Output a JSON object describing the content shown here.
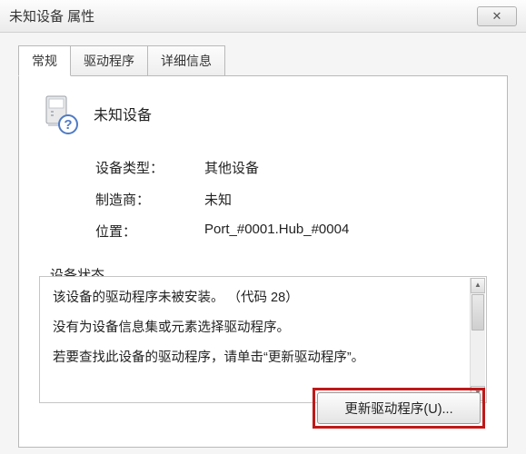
{
  "window": {
    "title": "未知设备 属性"
  },
  "tabs": {
    "general": "常规",
    "driver": "驱动程序",
    "details": "详细信息"
  },
  "device": {
    "name": "未知设备"
  },
  "info": {
    "type_label": "设备类型：",
    "type_value": "其他设备",
    "manufacturer_label": "制造商：",
    "manufacturer_value": "未知",
    "location_label": "位置：",
    "location_value": "Port_#0001.Hub_#0004"
  },
  "status": {
    "group_label": "设备状态",
    "line1": "该设备的驱动程序未被安装。 （代码 28）",
    "line2": "没有为设备信息集或元素选择驱动程序。",
    "line3": "若要查找此设备的驱动程序，请单击“更新驱动程序”。"
  },
  "buttons": {
    "update_driver": "更新驱动程序(U)...",
    "close_glyph": "✕"
  }
}
